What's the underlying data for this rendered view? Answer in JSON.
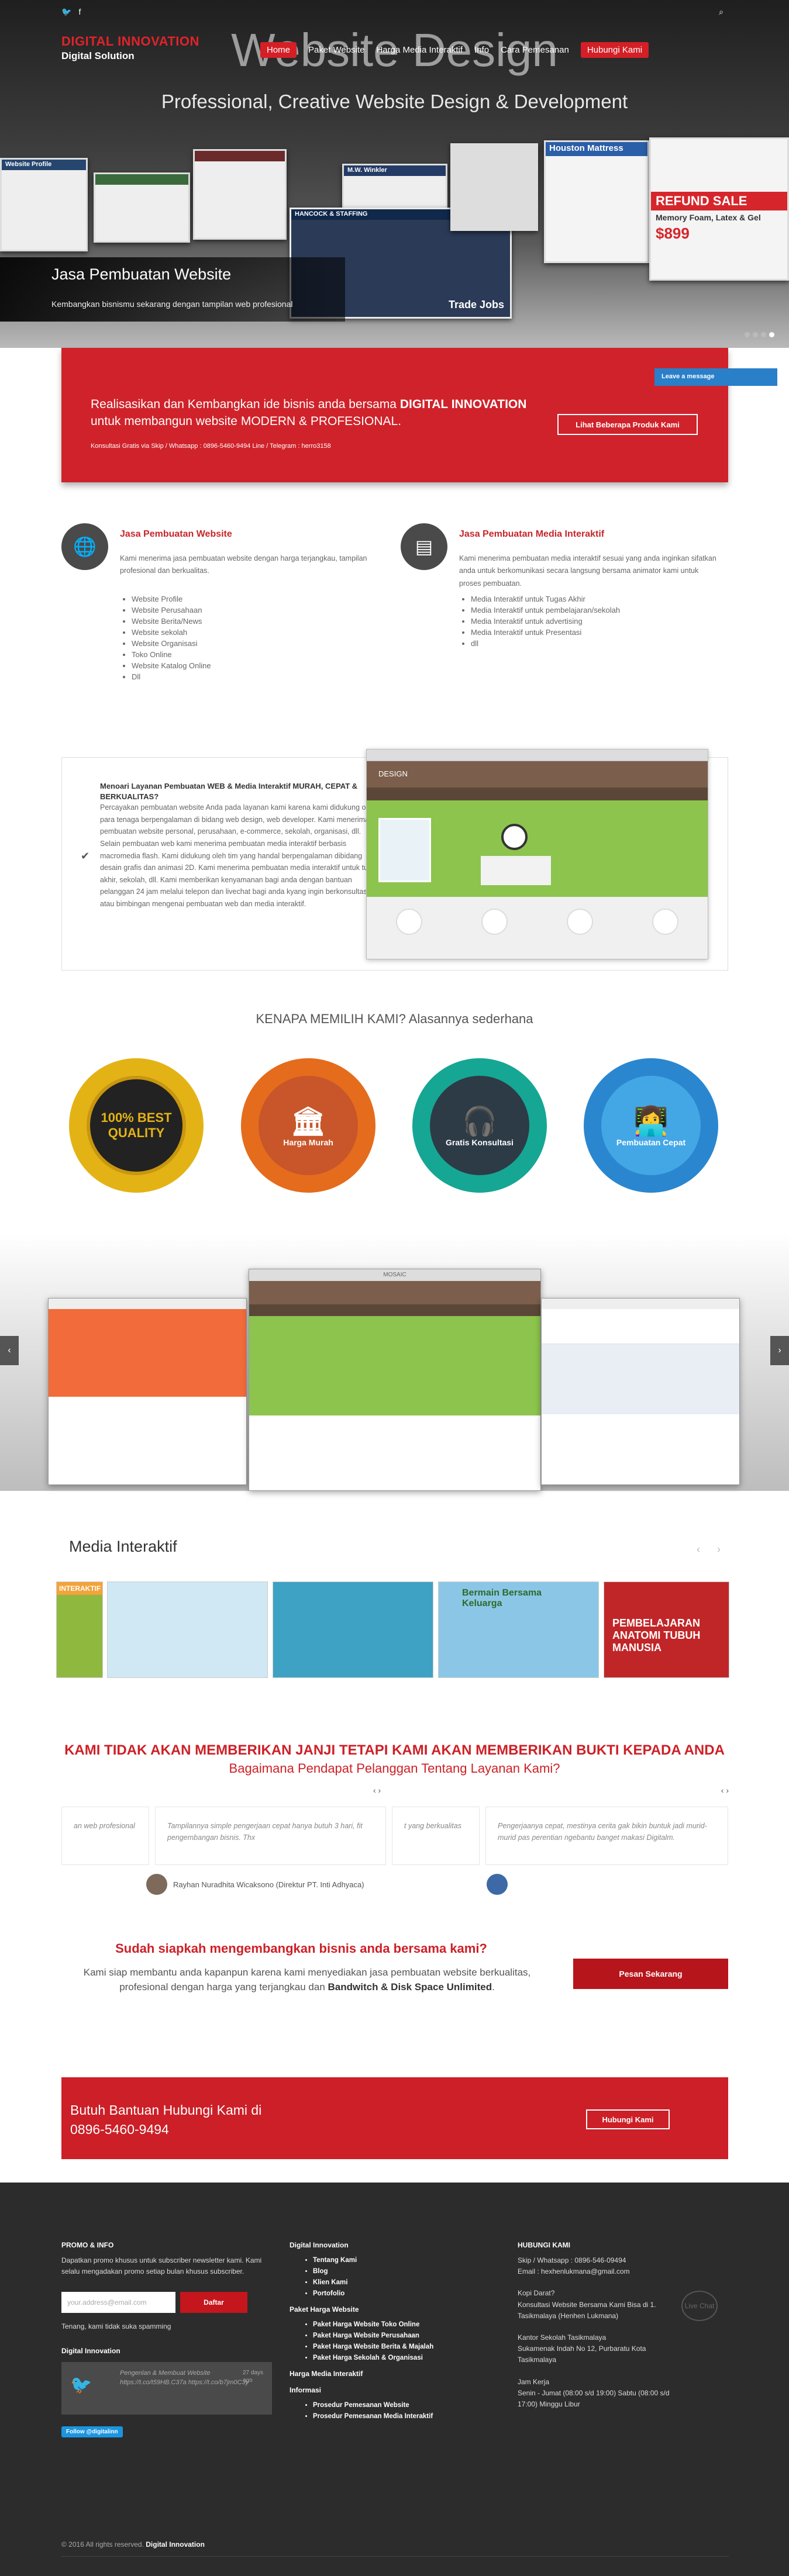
{
  "header": {
    "social": [
      "✉",
      "♥",
      "f"
    ],
    "logo_line1": "DIGITAL INNOVATION",
    "logo_line2": "Digital Solution",
    "nav": [
      "Home",
      "Paket Website",
      "Harga Media Interaktif",
      "Info",
      "Cara Pemesanan"
    ],
    "nav_cta": "Hubungi Kami",
    "search_icon": "⌕"
  },
  "hero": {
    "title": "Website Design",
    "subtitle": "Professional, Creative Website Design & Development",
    "caption_title": "Jasa Pembuatan Website",
    "caption_text": "Kembangkan bisnismu sekarang dengan tampilan web profesional",
    "cards": {
      "c1": "Website Profile",
      "c2": "M.W. Winkler",
      "c3": "HANCOCK & STAFFING",
      "c4": "Trade Jobs",
      "c5": "Houston Mattress",
      "c6": "REFUND SALE",
      "c7": "Memory Foam, Latex & Gel",
      "c8": "$899"
    }
  },
  "intro": {
    "line1": "Realisasikan dan Kembangkan ide bisnis anda bersama ",
    "bold1": "DIGITAL INNOVATION",
    "line2": " untuk membangun website ",
    "line3": "MODERN & PROFESIONAL.",
    "contact": "Konsultasi Gratis via Skip / Whatsapp : 0896-5460-9494 Line / Telegram : herro3158",
    "button": "Lihat Beberapa Produk Kami",
    "leave_message": "Leave a message"
  },
  "services": [
    {
      "title": "Jasa Pembuatan Website",
      "desc": "Kami menerima jasa pembuatan website dengan harga terjangkau, tampilan profesional dan berkualitas.",
      "items": [
        "Website Profile",
        "Website Perusahaan",
        "Website Berita/News",
        "Website sekolah",
        "Website Organisasi",
        "Toko Online",
        "Website Katalog Online",
        "Dll"
      ]
    },
    {
      "title": "Jasa Pembuatan Media Interaktif",
      "desc": "Kami menerima pembuatan media interaktif sesuai yang anda inginkan sifatkan anda untuk berkomunikasi secara langsung bersama animator kami untuk proses pembuatan.",
      "items": [
        "Media Interaktif untuk Tugas Akhir",
        "Media Interaktif untuk pembelajaran/sekolah",
        "Media Interaktif untuk advertising",
        "Media Interaktif untuk Presentasi",
        "dll"
      ]
    }
  ],
  "feature": {
    "heading": "Menoari Layanan Pembuatan WEB & Media Interaktif MURAH, CEPAT & BERKUALITAS?",
    "text": "Percayakan pembuatan website Anda pada layanan kami karena kami didukung oleh para tenaga berpengalaman di bidang web design, web developer. Kami menerima pembuatan website personal, perusahaan, e-commerce, sekolah, organisasi, dll. Selain pembuatan web kami menerima pembuatan media interaktif berbasis macromedia flash. Kami didukung oleh tim yang handal berpengalaman dibidang desain grafis dan animasi 2D. Kami menerima pembuatan media interaktif untuk tugas akhir, sekolah, dll. Kami memberikan kenyamanan bagi anda dengan bantuan pelanggan 24 jam melalui telepon dan livechat bagi anda kyang ingin berkonsultasi atau bimbingan mengenai pembuatan web dan media interaktif.",
    "browser_brand": "DESIGN"
  },
  "why": {
    "title": "KENAPA MEMILIH KAMI? Alasannya sederhana",
    "badges": [
      {
        "label": "100% BEST QUALITY",
        "color": "#e3b316"
      },
      {
        "label": "Harga Murah",
        "color": "#e46c1c"
      },
      {
        "label": "Gratis Konsultasi",
        "color": "#16a694"
      },
      {
        "label": "Pembuatan Cepat",
        "color": "#2a87cf"
      }
    ]
  },
  "gallery": {
    "prev": "‹",
    "next": "›",
    "center_title": "MOSAIC"
  },
  "media": {
    "title": "Media Interaktif",
    "arrows": "‹ ›",
    "thumbs": [
      "INTERAKTIF",
      "",
      "",
      "Bermain Bersama Keluarga",
      "PEMBELAJARAN ANATOMI TUBUH MANUSIA"
    ]
  },
  "testimonials": {
    "promise": "KAMI TIDAK AKAN MEMBERIKAN JANJI TETAPI KAMI AKAN MEMBERIKAN BUKTI KEPADA ANDA",
    "question": "Bagaimana Pendapat Pelanggan Tentang Layanan Kami?",
    "arrows": "‹ ›",
    "items": [
      "an web profesional",
      "Tampilannya simple pengerjaan cepat hanya butuh 3 hari, fit pengembangan bisnis. Thx",
      "t yang berkualitas",
      "Pengerjaanya cepat, mestinya cerita gak bikin buntuk jadi murid-murid pas perentian ngebantu banget makasi Digitalm."
    ],
    "author": "Rayhan Nuradhita Wicaksono (Direktur PT. Inti Adhyaca)"
  },
  "cta": {
    "heading": "Sudah siapkah mengembangkan bisnis anda bersama kami?",
    "text": "Kami siap membantu anda kapanpun karena kami menyediakan jasa pembuatan website berkualitas, profesional dengan harga yang terjangkau dan ",
    "bold": "Bandwitch & Disk Space Unlimited",
    "end": ".",
    "button": "Pesan Sekarang"
  },
  "help": {
    "line1": "Butuh Bantuan Hubungi Kami di",
    "line2": "0896-5460-9494",
    "button": "Hubungi Kami"
  },
  "footer": {
    "promo_title": "PROMO & INFO",
    "promo_text": "Dapatkan promo khusus untuk subscriber newsletter kami. Kami selalu mengadakan promo setiap bulan khusus subscriber.",
    "email_placeholder": "your.address@email.com",
    "subscribe_button": "Daftar",
    "no_spam": "Tenang, kami tidak suka spamming",
    "digital_innovation": "Digital Innovation",
    "tweet_text": "Pengenlan & Membuat Website https://t.co/t59HB.C37a https://t.co/b7jm0C3y",
    "tweet_date": "27 days ago",
    "follow": "Follow @digitalinn",
    "col2_title": "Digital Innovation",
    "col2_items": [
      "Tentang Kami",
      "Blog",
      "Klien Kami",
      "Portofolio"
    ],
    "col2b_title": "Paket Harga Website",
    "col2b_items": [
      "Paket Harga Website Toko Online",
      "Paket Harga Website Perusahaan",
      "Paket Harga Website Berita & Majalah",
      "Paket Harga Sekolah & Organisasi"
    ],
    "col2c_title": "Harga Media Interaktif",
    "col2d_title": "Informasi",
    "col2d_items": [
      "Prosedur Pemesanan Website",
      "Prosedur Pemesanan Media Interaktif"
    ],
    "col3_title": "HUBUNGI KAMI",
    "phone": "Skip / Whatsapp : 0896-546-09494",
    "email": "Email : hexhenlukmana@gmail.com",
    "kopi_title": "Kopi Darat?",
    "kopi_text": "Konsultasi Website Bersama Kami Bisa di 1. Tasikmalaya (Henhen Lukmana)",
    "office_title": "Kantor Sekolah Tasikmalaya",
    "office_text": "Sukamenak Indah No 12, Purbaratu Kota Tasikmalaya",
    "hours_title": "Jam Kerja",
    "hours": "Senin - Jumat (08:00 s/d 19:00) Sabtu (08:00 s/d 17:00) Minggu Libur",
    "chat_icon": "Live Chat",
    "copyright": "© 2016 All rights reserved. ",
    "copyright_brand": "Digital Innovation"
  }
}
